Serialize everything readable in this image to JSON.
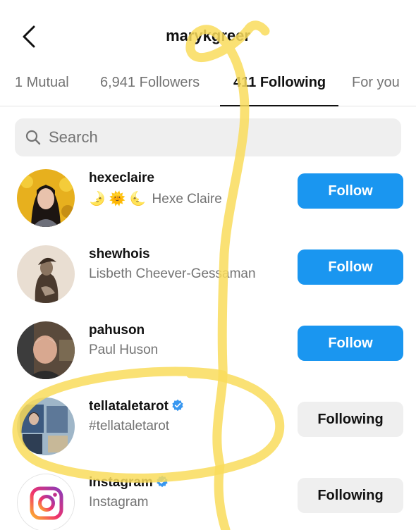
{
  "header": {
    "title": "marykgreer"
  },
  "tabs": [
    {
      "label": "1 Mutual"
    },
    {
      "label": "6,941 Followers"
    },
    {
      "label": "411 Following"
    },
    {
      "label": "For you"
    }
  ],
  "search": {
    "placeholder": "Search"
  },
  "users": [
    {
      "username": "hexeclaire",
      "display_name": "Hexe Claire",
      "emojis": "🌛 🌞 🌜",
      "button": "Follow",
      "verified": false
    },
    {
      "username": "shewhois",
      "display_name": "Lisbeth Cheever-Gessaman",
      "button": "Follow",
      "verified": false
    },
    {
      "username": "pahuson",
      "display_name": "Paul Huson",
      "button": "Follow",
      "verified": false
    },
    {
      "username": "tellataletarot",
      "display_name": "#tellataletarot",
      "button": "Following",
      "verified": true
    },
    {
      "username": "instagram",
      "display_name": "Instagram",
      "button": "Following",
      "verified": true
    }
  ],
  "colors": {
    "follow_blue": "#1a96f0",
    "verified_blue": "#3897f0",
    "highlight": "#f9dc5c"
  }
}
